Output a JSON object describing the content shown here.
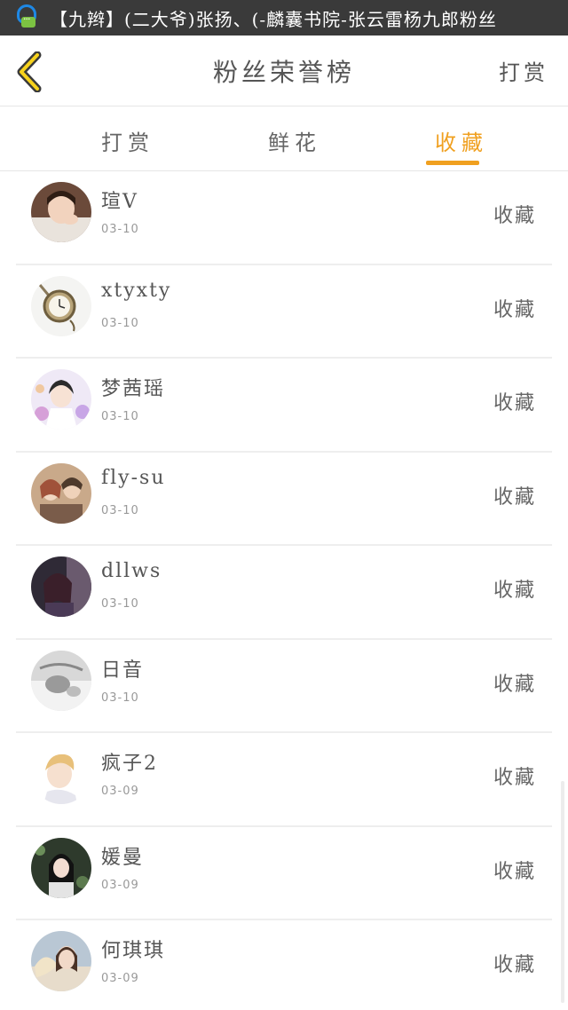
{
  "status_bar": {
    "notification_text": "【九辫】(二大爷)张扬、(-麟囊书院-张云雷杨九郎粉丝"
  },
  "header": {
    "back_icon": "chevron-left-icon",
    "title": "粉丝荣誉榜",
    "right_action": "打赏"
  },
  "tabs": [
    {
      "label": "打赏",
      "active": false
    },
    {
      "label": "鲜花",
      "active": false
    },
    {
      "label": "收藏",
      "active": true
    }
  ],
  "colors": {
    "accent": "#f0a020",
    "status_bar_bg": "#3a3a3a",
    "divider": "#eeeeee"
  },
  "fans": [
    {
      "name": "瑄V",
      "date": "03-10",
      "action": "收藏",
      "avatar": "girl-photo-avatar"
    },
    {
      "name": "xtyxty",
      "date": "03-10",
      "action": "收藏",
      "avatar": "pocket-watch-avatar"
    },
    {
      "name": "梦茜瑶",
      "date": "03-10",
      "action": "收藏",
      "avatar": "floral-girl-avatar"
    },
    {
      "name": "fly-su",
      "date": "03-10",
      "action": "收藏",
      "avatar": "illustrated-couple-avatar"
    },
    {
      "name": "dllws",
      "date": "03-10",
      "action": "收藏",
      "avatar": "anime-girl-avatar"
    },
    {
      "name": "日音",
      "date": "03-10",
      "action": "收藏",
      "avatar": "grayscale-photo-avatar"
    },
    {
      "name": "疯子2",
      "date": "03-09",
      "action": "收藏",
      "avatar": "anime-boy-avatar"
    },
    {
      "name": "媛曼",
      "date": "03-09",
      "action": "收藏",
      "avatar": "dark-portrait-avatar"
    },
    {
      "name": "何琪琪",
      "date": "03-09",
      "action": "收藏",
      "avatar": "girl-fan-avatar"
    }
  ]
}
